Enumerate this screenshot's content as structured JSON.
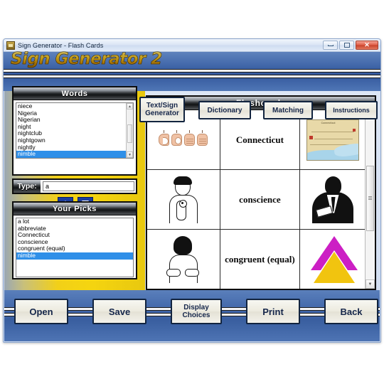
{
  "window": {
    "title": "Sign Generator - Flash Cards",
    "app_icon": "app-icon",
    "minimize_label": "Minimize",
    "maximize_label": "Maximize",
    "close_label": "Close",
    "close_glyph": "✕"
  },
  "header": {
    "brand_title": "Sign Generator 2",
    "nav": [
      {
        "label": "Text/Sign Generator",
        "name": "nav-text-sign-generator"
      },
      {
        "label": "Dictionary",
        "name": "nav-dictionary"
      },
      {
        "label": "Matching",
        "name": "nav-matching"
      },
      {
        "label": "Instructions",
        "name": "nav-instructions"
      }
    ]
  },
  "words_panel": {
    "title": "Words",
    "items": [
      "niece",
      "Nigeria",
      "Nigerian",
      "night",
      "nightclub",
      "nightgown",
      "nightly",
      "nimble"
    ],
    "selected": "nimble",
    "selected_index": 7
  },
  "type_field": {
    "label": "Type:",
    "value": "a",
    "placeholder": ""
  },
  "transfer_buttons": {
    "up_label": "Move Up",
    "down_label": "Move Down"
  },
  "picks_panel": {
    "title": "Your Picks",
    "items": [
      "a lot",
      "abbreviate",
      "Connecticut",
      "conscience",
      "congruent (equal)",
      "nimble"
    ],
    "selected": "nimble",
    "selected_index": 5
  },
  "flashcards_panel": {
    "title": "Flashcards",
    "rows": [
      {
        "word": "Connecticut",
        "sign_type": "fingerspell",
        "sign_letters": [
          "C",
          "O",
          "N",
          "N"
        ],
        "picture": "map-connecticut",
        "picture_label": "Connecticut"
      },
      {
        "word": "conscience",
        "sign_type": "person-sign",
        "picture": "judge-gavel-silhouette"
      },
      {
        "word": "congruent (equal)",
        "sign_type": "person-sign-two-hands",
        "picture": "two-triangles"
      }
    ],
    "scrollbar": {
      "up_glyph": "▲",
      "down_glyph": "▼"
    }
  },
  "bottom_bar": {
    "buttons": [
      {
        "label": "Open",
        "name": "open-button"
      },
      {
        "label": "Save",
        "name": "save-button"
      },
      {
        "label": "Display Choices",
        "name": "display-choices-button"
      },
      {
        "label": "Print",
        "name": "print-button"
      },
      {
        "label": "Back",
        "name": "back-button"
      }
    ],
    "display_choices_line1": "Display",
    "display_choices_line2": "Choices"
  },
  "colors": {
    "banner_blue": "#3f65a8",
    "panel_yellow": "#f2d018",
    "selection_blue": "#2f8fe8",
    "button_text": "#15264a",
    "brand_gold": "#f5c51f",
    "magenta": "#cc1fc4",
    "yellow_triangle": "#f1c40f"
  }
}
